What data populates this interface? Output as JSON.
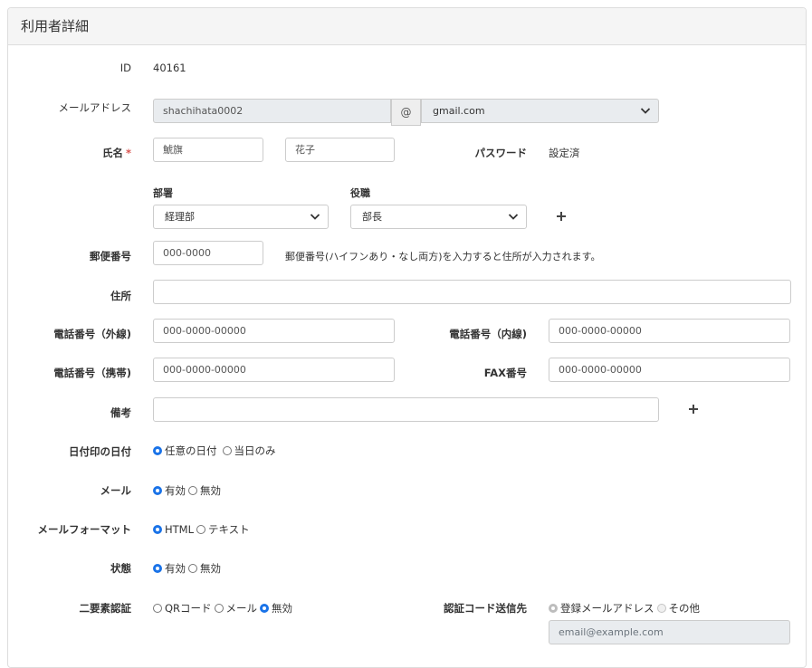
{
  "panel": {
    "title": "利用者詳細"
  },
  "fields": {
    "id": {
      "label": "ID",
      "value": "40161"
    },
    "email": {
      "label": "メールアドレス",
      "local_part": "shachihata0002",
      "at": "@",
      "domain_selected": "gmail.com"
    },
    "name": {
      "label": "氏名",
      "required_mark": "*",
      "last_name": "鯱旗",
      "first_name": "花子"
    },
    "password": {
      "label": "パスワード",
      "value": "設定済"
    },
    "department": {
      "label": "部署",
      "selected": "経理部"
    },
    "position": {
      "label": "役職",
      "selected": "部長"
    },
    "add_org_icon": "plus-icon",
    "postal": {
      "label": "郵便番号",
      "placeholder": "000-0000",
      "hint": "郵便番号(ハイフンあり・なし両方)を入力すると住所が入力されます。"
    },
    "address": {
      "label": "住所",
      "value": ""
    },
    "phone_external": {
      "label": "電話番号（外線)",
      "placeholder": "000-0000-00000"
    },
    "phone_internal": {
      "label": "電話番号（内線)",
      "placeholder": "000-0000-00000"
    },
    "phone_mobile": {
      "label": "電話番号（携帯)",
      "placeholder": "000-0000-00000"
    },
    "fax": {
      "label": "FAX番号",
      "placeholder": "000-0000-00000"
    },
    "notes": {
      "label": "備考",
      "value": ""
    },
    "stamp_date": {
      "label": "日付印の日付",
      "options": [
        "任意の日付",
        "当日のみ"
      ],
      "selected": 0
    },
    "mail": {
      "label": "メール",
      "options": [
        "有効",
        "無効"
      ],
      "selected": 0
    },
    "mail_format": {
      "label": "メールフォーマット",
      "options": [
        "HTML",
        "テキスト"
      ],
      "selected": 0
    },
    "status": {
      "label": "状態",
      "options": [
        "有効",
        "無効"
      ],
      "selected": 0
    },
    "two_factor": {
      "label": "二要素認証",
      "options": [
        "QRコード",
        "メール",
        "無効"
      ],
      "selected": 2
    },
    "auth_dest": {
      "label": "認証コード送信先",
      "options": [
        "登録メールアドレス",
        "その他"
      ],
      "selected": 0,
      "email_placeholder": "email@example.com"
    }
  },
  "colors": {
    "accent": "#1a73e8",
    "required": "#d9534f",
    "border": "#cccccc",
    "header_bg": "#f5f5f5",
    "disabled_bg": "#e9ecef"
  }
}
